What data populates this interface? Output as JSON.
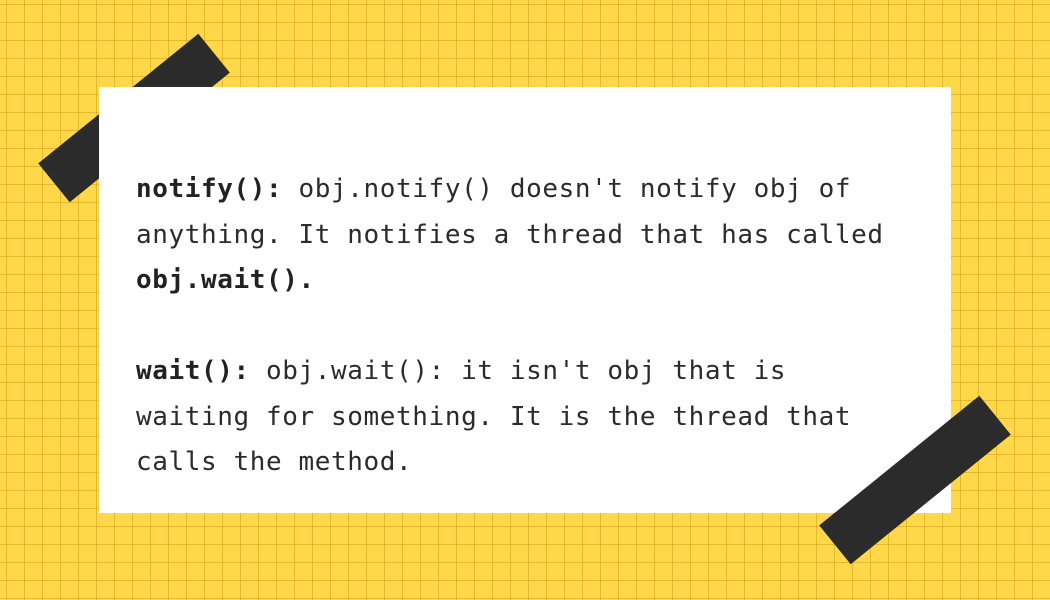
{
  "notes": [
    {
      "keyword": "notify():",
      "text_before_code": " obj.notify() doesn't notify obj of anything. It notifies a thread that has called ",
      "code": "obj.wait().",
      "text_after_code": ""
    },
    {
      "keyword": "wait():",
      "text_before_code": " obj.wait(): it isn't obj that is waiting for something. It is the thread that calls the method.",
      "code": "",
      "text_after_code": ""
    }
  ],
  "colors": {
    "background": "#ffd84a",
    "grid": "#d2a014",
    "card": "#ffffff",
    "tape": "#2b2b2b",
    "text": "#2b2b2b"
  }
}
